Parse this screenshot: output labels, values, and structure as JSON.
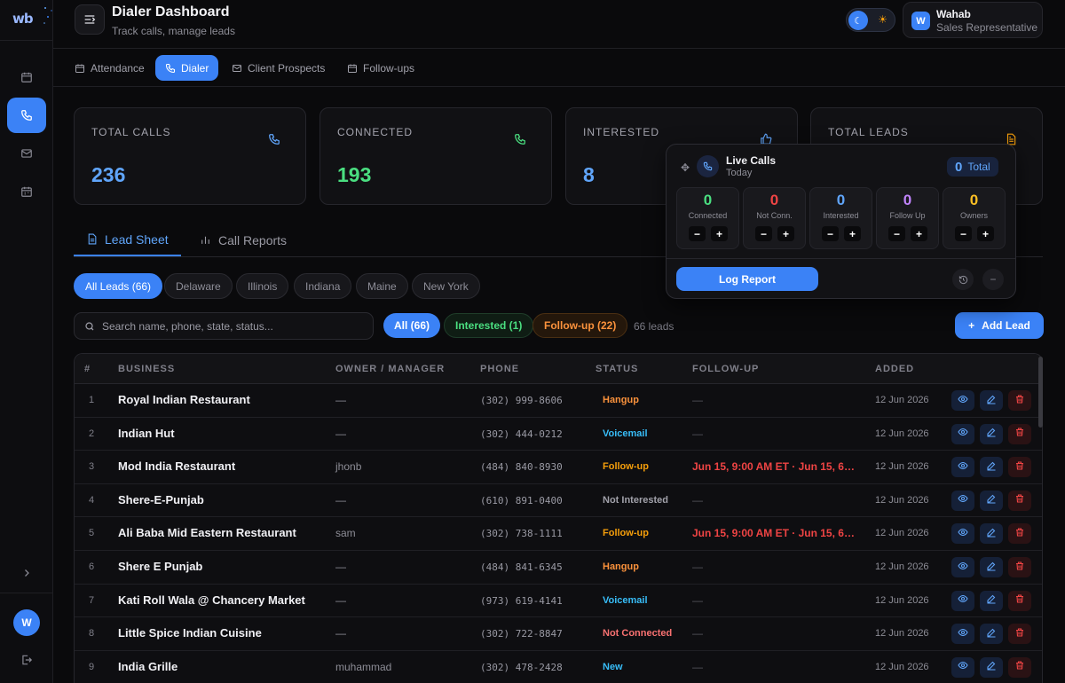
{
  "app": {
    "logo": "wb"
  },
  "header": {
    "title": "Dialer Dashboard",
    "subtitle": "Track calls, manage leads"
  },
  "user": {
    "initial": "W",
    "name": "Wahab",
    "role": "Sales Representative"
  },
  "nav": {
    "tabs": [
      {
        "label": "Attendance",
        "icon": "calendar-icon"
      },
      {
        "label": "Dialer",
        "icon": "phone-icon",
        "active": true
      },
      {
        "label": "Client Prospects",
        "icon": "mail-icon"
      },
      {
        "label": "Follow-ups",
        "icon": "calendar-icon"
      }
    ]
  },
  "stats": [
    {
      "label": "TOTAL CALLS",
      "value": "236",
      "color": "#60a5fa",
      "icon": "phone-icon"
    },
    {
      "label": "CONNECTED",
      "value": "193",
      "color": "#4ade80",
      "icon": "phone-icon"
    },
    {
      "label": "INTERESTED",
      "value": "8",
      "color": "#60a5fa",
      "icon": "thumbs-up-icon"
    },
    {
      "label": "TOTAL LEADS",
      "value": "",
      "color": "#f59e0b",
      "icon": "document-icon"
    }
  ],
  "live_calls": {
    "title": "Live Calls",
    "subtitle": "Today",
    "total_value": "0",
    "total_label": "Total",
    "counters": [
      {
        "value": "0",
        "label": "Connected",
        "color": "#4ade80"
      },
      {
        "value": "0",
        "label": "Not Conn.",
        "color": "#ef4444"
      },
      {
        "value": "0",
        "label": "Interested",
        "color": "#60a5fa"
      },
      {
        "value": "0",
        "label": "Follow Up",
        "color": "#c084fc"
      },
      {
        "value": "0",
        "label": "Owners",
        "color": "#fbbf24"
      }
    ],
    "minus": "−",
    "plus": "+",
    "log_button": "Log Report"
  },
  "subtabs": {
    "lead_sheet": "Lead Sheet",
    "call_reports": "Call Reports"
  },
  "state_filters": [
    "All Leads (66)",
    "Delaware",
    "Illinois",
    "Indiana",
    "Maine",
    "New York"
  ],
  "search": {
    "placeholder": "Search name, phone, state, status..."
  },
  "status_filters": {
    "all": "All (66)",
    "interested": "Interested (1)",
    "followup": "Follow-up (22)",
    "count": "66 leads"
  },
  "add_lead": "Add Lead",
  "table": {
    "headers": [
      "#",
      "BUSINESS",
      "OWNER / MANAGER",
      "PHONE",
      "STATUS",
      "FOLLOW-UP",
      "ADDED"
    ],
    "rows": [
      {
        "num": "1",
        "business": "Royal Indian Restaurant",
        "owner": "—",
        "phone": "(302) 999-8606",
        "status": "Hangup",
        "status_color": "#fb923c",
        "followup": "—",
        "added": "12 Jun 2026"
      },
      {
        "num": "2",
        "business": "Indian Hut",
        "owner": "—",
        "phone": "(302) 444-0212",
        "status": "Voicemail",
        "status_color": "#38bdf8",
        "followup": "—",
        "added": "12 Jun 2026"
      },
      {
        "num": "3",
        "business": "Mod India Restaurant",
        "owner": "jhonb",
        "phone": "(484) 840-8930",
        "status": "Follow-up",
        "status_color": "#f59e0b",
        "followup": "Jun 15, 9:00 AM ET · Jun 15, 6:0...",
        "added": "12 Jun 2026"
      },
      {
        "num": "4",
        "business": "Shere-E-Punjab",
        "owner": "—",
        "phone": "(610) 891-0400",
        "status": "Not Interested",
        "status_color": "#a1a1aa",
        "followup": "—",
        "added": "12 Jun 2026"
      },
      {
        "num": "5",
        "business": "Ali Baba Mid Eastern Restaurant",
        "owner": "sam",
        "phone": "(302) 738-1111",
        "status": "Follow-up",
        "status_color": "#f59e0b",
        "followup": "Jun 15, 9:00 AM ET · Jun 15, 6:0...",
        "added": "12 Jun 2026"
      },
      {
        "num": "6",
        "business": "Shere E Punjab",
        "owner": "—",
        "phone": "(484) 841-6345",
        "status": "Hangup",
        "status_color": "#fb923c",
        "followup": "—",
        "added": "12 Jun 2026"
      },
      {
        "num": "7",
        "business": "Kati Roll Wala @ Chancery Market",
        "owner": "—",
        "phone": "(973) 619-4141",
        "status": "Voicemail",
        "status_color": "#38bdf8",
        "followup": "—",
        "added": "12 Jun 2026"
      },
      {
        "num": "8",
        "business": "Little Spice Indian Cuisine",
        "owner": "—",
        "phone": "(302) 722-8847",
        "status": "Not Connected",
        "status_color": "#f87171",
        "followup": "—",
        "added": "12 Jun 2026"
      },
      {
        "num": "9",
        "business": "India Grille",
        "owner": "muhammad",
        "phone": "(302) 478-2428",
        "status": "New",
        "status_color": "#38bdf8",
        "followup": "—",
        "added": "12 Jun 2026"
      }
    ]
  }
}
